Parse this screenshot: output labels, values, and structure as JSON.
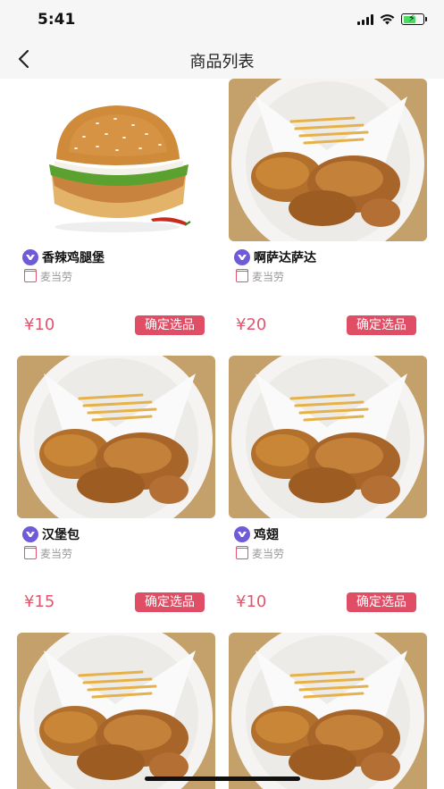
{
  "status_bar": {
    "time": "5:41"
  },
  "nav": {
    "title": "商品列表"
  },
  "products": [
    {
      "name": "香辣鸡腿堡",
      "shop": "麦当劳",
      "price": "¥10",
      "button": "确定选品",
      "image": "burger"
    },
    {
      "name": "啊萨达萨达",
      "shop": "麦当劳",
      "price": "¥20",
      "button": "确定选品",
      "image": "chicken-fries"
    },
    {
      "name": "汉堡包",
      "shop": "麦当劳",
      "price": "¥15",
      "button": "确定选品",
      "image": "chicken-fries"
    },
    {
      "name": "鸡翅",
      "shop": "麦当劳",
      "price": "¥10",
      "button": "确定选品",
      "image": "chicken-fries"
    },
    {
      "image": "chicken-fries"
    },
    {
      "image": "chicken-fries"
    }
  ],
  "colors": {
    "accent": "#e04e66",
    "badge": "#6f5bd8",
    "nav_bg": "#f6f6f6"
  }
}
